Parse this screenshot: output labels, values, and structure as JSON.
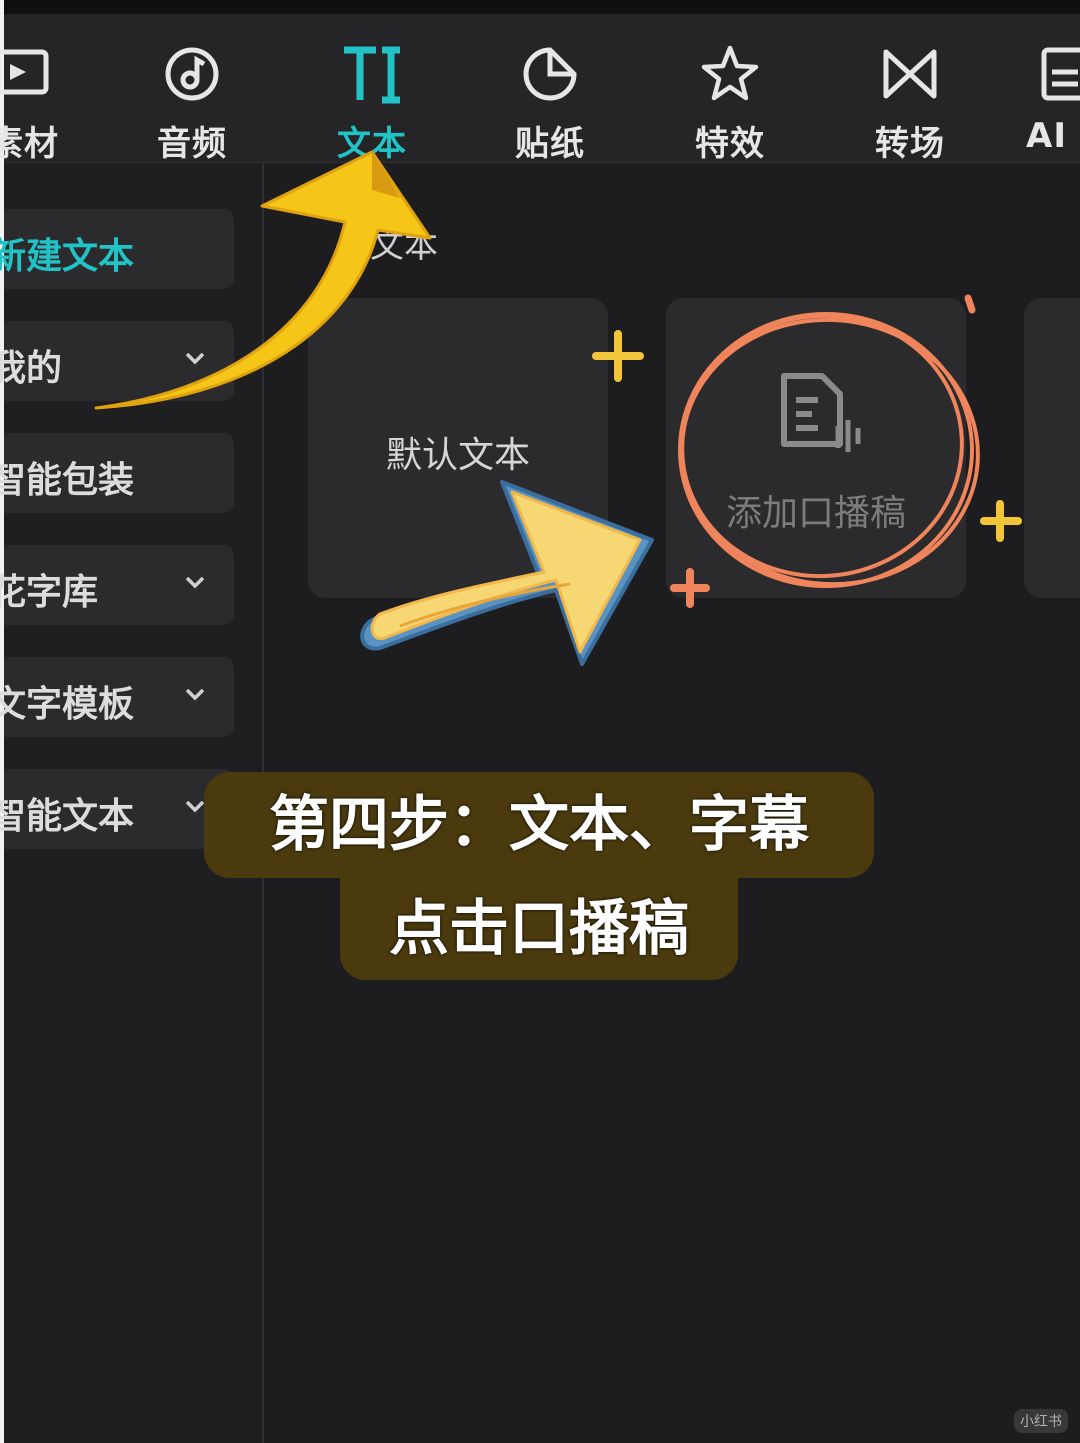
{
  "toolbar": {
    "tabs": [
      {
        "label": "素材",
        "icon": "media-icon"
      },
      {
        "label": "音频",
        "icon": "audio-icon"
      },
      {
        "label": "文本",
        "icon": "text-icon",
        "active": true
      },
      {
        "label": "贴纸",
        "icon": "sticker-icon"
      },
      {
        "label": "特效",
        "icon": "effects-icon"
      },
      {
        "label": "转场",
        "icon": "transition-icon"
      },
      {
        "label": "AI",
        "icon": "ai-icon"
      }
    ]
  },
  "sidebar": {
    "items": [
      {
        "label": "新建文本",
        "active": true
      },
      {
        "label": "我的",
        "has_chevron": true
      },
      {
        "label": "智能包装"
      },
      {
        "label": "花字库",
        "has_chevron": true
      },
      {
        "label": "文字模板",
        "has_chevron": true
      },
      {
        "label": "智能文本",
        "has_chevron": true
      }
    ]
  },
  "content": {
    "section_title": "文本",
    "cards": [
      {
        "label": "默认文本"
      },
      {
        "label": "添加口播稿",
        "icon": "script-mic-icon"
      }
    ]
  },
  "annotation": {
    "caption_line1": "第四步：文本、字幕",
    "caption_line2": "点击口播稿"
  },
  "watermark": "小红书",
  "colors": {
    "accent": "#22c3c6",
    "arrow_yellow": "#f5c518",
    "circle_orange": "#f0845a",
    "caption_bg": "#4a3a0e"
  }
}
